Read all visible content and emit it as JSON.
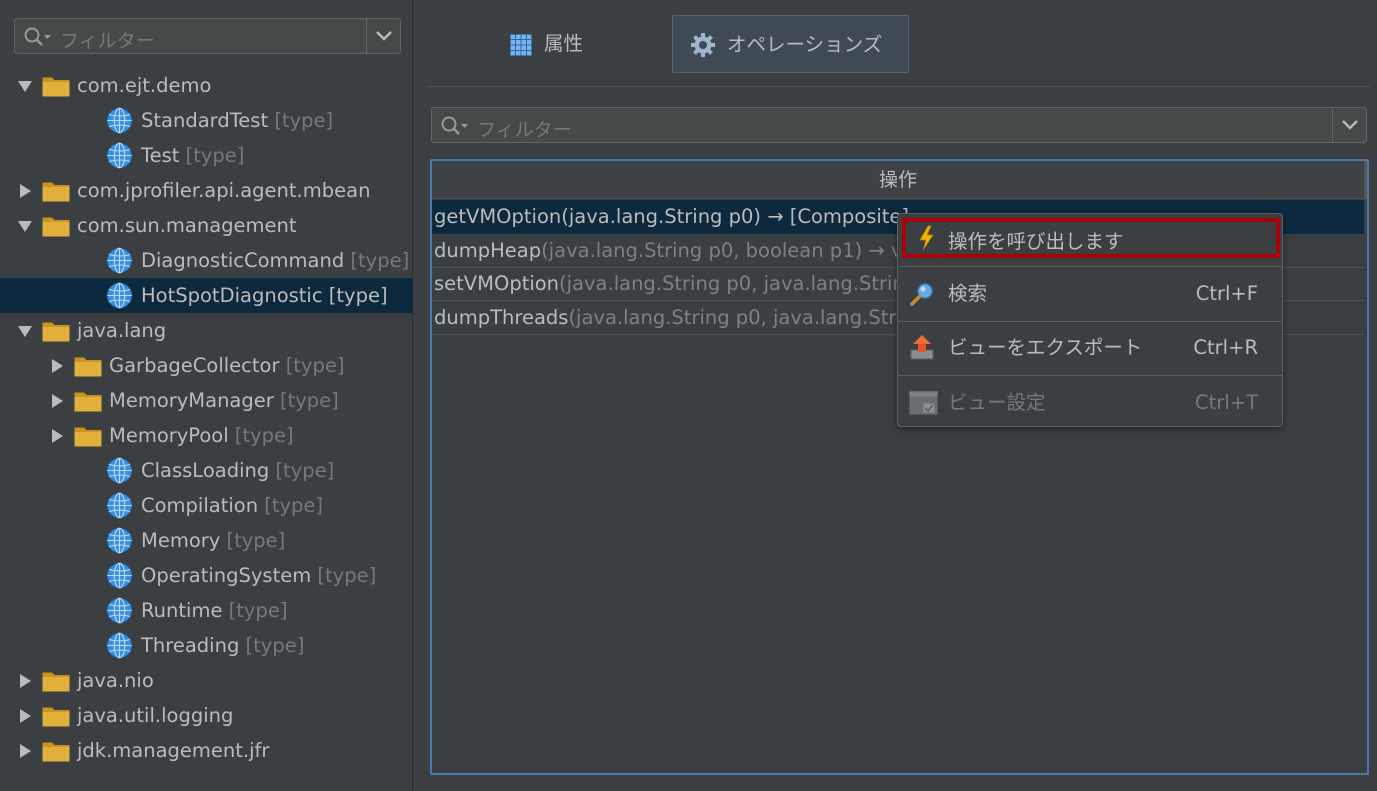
{
  "left_panel": {
    "filter": {
      "placeholder": "フィルター"
    },
    "tree": [
      {
        "label": "com.ejt.demo",
        "type": "",
        "depth": 0,
        "kind": "folder",
        "expanded": true,
        "has_arrow": true
      },
      {
        "label": "StandardTest",
        "type": "[type]",
        "depth": 1,
        "kind": "globe",
        "has_arrow": false
      },
      {
        "label": "Test",
        "type": "[type]",
        "depth": 1,
        "kind": "globe",
        "has_arrow": false
      },
      {
        "label": "com.jprofiler.api.agent.mbean",
        "type": "",
        "depth": 0,
        "kind": "folder",
        "expanded": false,
        "has_arrow": true
      },
      {
        "label": "com.sun.management",
        "type": "",
        "depth": 0,
        "kind": "folder",
        "expanded": true,
        "has_arrow": true
      },
      {
        "label": "DiagnosticCommand",
        "type": "[type]",
        "depth": 1,
        "kind": "globe",
        "has_arrow": false
      },
      {
        "label": "HotSpotDiagnostic",
        "type": "[type]",
        "depth": 1,
        "kind": "globe",
        "has_arrow": false,
        "selected": true
      },
      {
        "label": "java.lang",
        "type": "",
        "depth": 0,
        "kind": "folder",
        "expanded": true,
        "has_arrow": true
      },
      {
        "label": "GarbageCollector",
        "type": "[type]",
        "depth": 1,
        "kind": "folder",
        "expanded": false,
        "has_arrow": true
      },
      {
        "label": "MemoryManager",
        "type": "[type]",
        "depth": 1,
        "kind": "folder",
        "expanded": false,
        "has_arrow": true
      },
      {
        "label": "MemoryPool",
        "type": "[type]",
        "depth": 1,
        "kind": "folder",
        "expanded": false,
        "has_arrow": true
      },
      {
        "label": "ClassLoading",
        "type": "[type]",
        "depth": 1,
        "kind": "globe",
        "has_arrow": false
      },
      {
        "label": "Compilation",
        "type": "[type]",
        "depth": 1,
        "kind": "globe",
        "has_arrow": false
      },
      {
        "label": "Memory",
        "type": "[type]",
        "depth": 1,
        "kind": "globe",
        "has_arrow": false
      },
      {
        "label": "OperatingSystem",
        "type": "[type]",
        "depth": 1,
        "kind": "globe",
        "has_arrow": false
      },
      {
        "label": "Runtime",
        "type": "[type]",
        "depth": 1,
        "kind": "globe",
        "has_arrow": false
      },
      {
        "label": "Threading",
        "type": "[type]",
        "depth": 1,
        "kind": "globe",
        "has_arrow": false
      },
      {
        "label": "java.nio",
        "type": "",
        "depth": 0,
        "kind": "folder",
        "expanded": false,
        "has_arrow": true
      },
      {
        "label": "java.util.logging",
        "type": "",
        "depth": 0,
        "kind": "folder",
        "expanded": false,
        "has_arrow": true
      },
      {
        "label": "jdk.management.jfr",
        "type": "",
        "depth": 0,
        "kind": "folder",
        "expanded": false,
        "has_arrow": true
      }
    ]
  },
  "right_panel": {
    "tabs": [
      {
        "label": "属性",
        "icon": "grid-icon",
        "active": false
      },
      {
        "label": "オペレーションズ",
        "icon": "gear-icon",
        "active": true
      }
    ],
    "filter": {
      "placeholder": "フィルター"
    },
    "table": {
      "header": "操作",
      "rows": [
        {
          "method": "getVMOption",
          "args": "(java.lang.String p0) → [Composite]",
          "selected": true
        },
        {
          "method": "dumpHeap",
          "args": "(java.lang.String p0, boolean p1) → void",
          "selected": false
        },
        {
          "method": "setVMOption",
          "args": "(java.lang.String p0, java.lang.String p1) → void",
          "selected": false
        },
        {
          "method": "dumpThreads",
          "args": "(java.lang.String p0, java.lang.String p1) → void",
          "selected": false
        }
      ]
    }
  },
  "context_menu": {
    "items": [
      {
        "label": "操作を呼び出します",
        "shortcut": "",
        "icon": "lightning-icon",
        "highlighted": true,
        "enabled": true
      },
      {
        "label": "検索",
        "shortcut": "Ctrl+F",
        "icon": "magnifier-icon",
        "enabled": true
      },
      {
        "label": "ビューをエクスポート",
        "shortcut": "Ctrl+R",
        "icon": "export-icon",
        "enabled": true
      },
      {
        "label": "ビュー設定",
        "shortcut": "Ctrl+T",
        "icon": "view-settings-icon",
        "enabled": false
      }
    ]
  },
  "colors": {
    "background": "#3c3f41",
    "selection": "#0d293e",
    "table_focus_border": "#4a78aa",
    "highlight_border": "#a8000a",
    "folder": "#e1b03a",
    "globe": "#3b8fdc"
  }
}
